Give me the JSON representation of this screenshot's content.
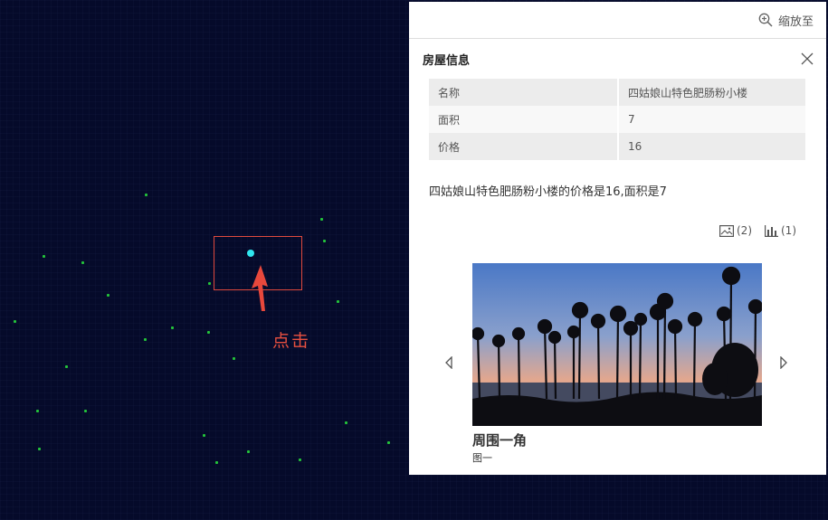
{
  "map": {
    "click_label": "点击",
    "dot_color": "#23c33a",
    "selected_color": "#30e6ef",
    "highlight_color": "#e04a3e"
  },
  "panel": {
    "zoom_label": "缩放至",
    "title": "房屋信息",
    "rows": [
      {
        "key": "名称",
        "value": "四姑娘山特色肥肠粉小楼"
      },
      {
        "key": "面积",
        "value": "7"
      },
      {
        "key": "价格",
        "value": "16"
      }
    ],
    "description": "四姑娘山特色肥肠粉小楼的价格是16,面积是7",
    "image_count": "(2)",
    "chart_count": "(1)",
    "carousel": {
      "title": "周围一角",
      "subtitle": "图一"
    }
  }
}
